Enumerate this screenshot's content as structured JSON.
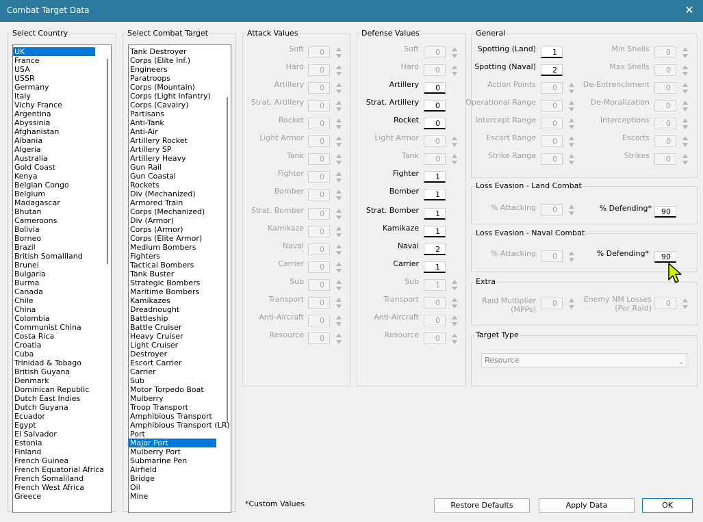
{
  "window": {
    "title": "Combat Target Data",
    "close_glyph": "✕"
  },
  "country": {
    "group_label": "Select Country",
    "items": [
      "UK",
      "France",
      "USA",
      "USSR",
      "Germany",
      "Italy",
      "Vichy France",
      "Argentina",
      "Abyssinia",
      "Afghanistan",
      "Albania",
      "Algeria",
      "Australia",
      "Gold Coast",
      "Kenya",
      "Belgian Congo",
      "Belgium",
      "Madagascar",
      "Bhutan",
      "Cameroons",
      "Bolivia",
      "Borneo",
      "Brazil",
      "British Somaliland",
      "Brunei",
      "Bulgaria",
      "Burma",
      "Canada",
      "Chile",
      "China",
      "Colombia",
      "Communist China",
      "Costa Rica",
      "Croatia",
      "Cuba",
      "Trinidad & Tobago",
      "British Guyana",
      "Denmark",
      "Dominican Republic",
      "Dutch East Indies",
      "Dutch Guyana",
      "Ecuador",
      "Egypt",
      "El Salvador",
      "Estonia",
      "Finland",
      "French Guinea",
      "French Equatorial Africa",
      "French Somaliland",
      "French West Africa",
      "Greece"
    ],
    "selected": "UK"
  },
  "target": {
    "group_label": "Select Combat Target",
    "items": [
      "Tank Destroyer",
      "Corps (Elite Inf.)",
      "Engineers",
      "Paratroops",
      "Corps (Mountain)",
      "Corps (Light Infantry)",
      "Corps (Cavalry)",
      "Partisans",
      "Anti-Tank",
      "Anti-Air",
      "Artillery Rocket",
      "Artillery SP",
      "Artillery Heavy",
      "Gun Rail",
      "Gun Coastal",
      "Rockets",
      "Div (Mechanized)",
      "Armored Train",
      "Corps (Mechanized)",
      "Div (Armor)",
      "Corps (Armor)",
      "Corps (Elite Armor)",
      "Medium Bombers",
      "Fighters",
      "Tactical Bombers",
      "Tank Buster",
      "Strategic Bombers",
      "Maritime Bombers",
      "Kamikazes",
      "Dreadnought",
      "Battleship",
      "Battle Cruiser",
      "Heavy Cruiser",
      "Light Cruiser",
      "Destroyer",
      "Escort Carrier",
      "Carrier",
      "Sub",
      "Motor Torpedo Boat",
      "Mulberry",
      "Troop Transport",
      "Amphibious Transport",
      "Amphibious Transport (LR)",
      "Port",
      "Major Port",
      "Mulberry Port",
      "Submarine Pen",
      "Airfield",
      "Bridge",
      "Oil",
      "Mine"
    ],
    "selected": "Major Port"
  },
  "attack": {
    "group_label": "Attack Values",
    "rows": [
      {
        "label": "Soft",
        "value": "0",
        "enabled": false
      },
      {
        "label": "Hard",
        "value": "0",
        "enabled": false
      },
      {
        "label": "Artillery",
        "value": "0",
        "enabled": false
      },
      {
        "label": "Strat. Artillery",
        "value": "0",
        "enabled": false
      },
      {
        "label": "Rocket",
        "value": "0",
        "enabled": false
      },
      {
        "label": "Light Armor",
        "value": "0",
        "enabled": false
      },
      {
        "label": "Tank",
        "value": "0",
        "enabled": false
      },
      {
        "label": "Fighter",
        "value": "0",
        "enabled": false
      },
      {
        "label": "Bomber",
        "value": "0",
        "enabled": false
      },
      {
        "label": "Strat. Bomber",
        "value": "0",
        "enabled": false
      },
      {
        "label": "Kamikaze",
        "value": "0",
        "enabled": false
      },
      {
        "label": "Naval",
        "value": "0",
        "enabled": false
      },
      {
        "label": "Carrier",
        "value": "0",
        "enabled": false
      },
      {
        "label": "Sub",
        "value": "0",
        "enabled": false
      },
      {
        "label": "Transport",
        "value": "0",
        "enabled": false
      },
      {
        "label": "Anti-Aircraft",
        "value": "0",
        "enabled": false
      },
      {
        "label": "Resource",
        "value": "0",
        "enabled": false
      }
    ]
  },
  "defense": {
    "group_label": "Defense Values",
    "rows": [
      {
        "label": "Soft",
        "value": "0",
        "enabled": false
      },
      {
        "label": "Hard",
        "value": "0",
        "enabled": false
      },
      {
        "label": "Artillery",
        "value": "0",
        "enabled": true
      },
      {
        "label": "Strat. Artillery",
        "value": "0",
        "enabled": true
      },
      {
        "label": "Rocket",
        "value": "0",
        "enabled": true
      },
      {
        "label": "Light Armor",
        "value": "0",
        "enabled": false
      },
      {
        "label": "Tank",
        "value": "0",
        "enabled": false
      },
      {
        "label": "Fighter",
        "value": "1",
        "enabled": true
      },
      {
        "label": "Bomber",
        "value": "1",
        "enabled": true
      },
      {
        "label": "Strat. Bomber",
        "value": "1",
        "enabled": true
      },
      {
        "label": "Kamikaze",
        "value": "1",
        "enabled": true
      },
      {
        "label": "Naval",
        "value": "2",
        "enabled": true
      },
      {
        "label": "Carrier",
        "value": "1",
        "enabled": true
      },
      {
        "label": "Sub",
        "value": "1",
        "enabled": false
      },
      {
        "label": "Transport",
        "value": "0",
        "enabled": false
      },
      {
        "label": "Anti-Aircraft",
        "value": "0",
        "enabled": false
      },
      {
        "label": "Resource",
        "value": "0",
        "enabled": false
      }
    ]
  },
  "general": {
    "group_label": "General",
    "left": [
      {
        "label": "Spotting (Land)",
        "value": "1",
        "enabled": true
      },
      {
        "label": "Spotting (Naval)",
        "value": "2",
        "enabled": true
      },
      {
        "label": "Action Points",
        "value": "0",
        "enabled": false
      },
      {
        "label": "Operational Range",
        "value": "0",
        "enabled": false
      },
      {
        "label": "Intercept Range",
        "value": "0",
        "enabled": false
      },
      {
        "label": "Escort Range",
        "value": "0",
        "enabled": false
      },
      {
        "label": "Strike Range",
        "value": "0",
        "enabled": false
      }
    ],
    "right": [
      {
        "label": "Min Shells",
        "value": "0",
        "enabled": false
      },
      {
        "label": "Max Shells",
        "value": "0",
        "enabled": false
      },
      {
        "label": "De-Entrenchment",
        "value": "0",
        "enabled": false
      },
      {
        "label": "De-Moralization",
        "value": "0",
        "enabled": false
      },
      {
        "label": "Interceptions",
        "value": "0",
        "enabled": false
      },
      {
        "label": "Escorts",
        "value": "0",
        "enabled": false
      },
      {
        "label": "Strikes",
        "value": "0",
        "enabled": false
      }
    ]
  },
  "loss_land": {
    "group_label": "Loss Evasion - Land Combat",
    "attacking_label": "% Attacking",
    "attacking_value": "0",
    "defending_label": "% Defending*",
    "defending_value": "90"
  },
  "loss_naval": {
    "group_label": "Loss Evasion - Naval Combat",
    "attacking_label": "% Attacking",
    "attacking_value": "0",
    "defending_label": "% Defending*",
    "defending_value": "90"
  },
  "extra": {
    "group_label": "Extra",
    "raid_label_1": "Raid Multiplier",
    "raid_label_2": "(MPPs)",
    "raid_value": "0",
    "enemy_label_1": "Enemy NM Losses",
    "enemy_label_2": "(Per Raid)",
    "enemy_value": "0"
  },
  "target_type": {
    "group_label": "Target Type",
    "value": "Resource"
  },
  "footer": {
    "note": "*Custom Values",
    "restore_label": "Restore Defaults",
    "apply_label": "Apply Data",
    "ok_label": "OK"
  },
  "colors": {
    "titlebar": "#2c7a9e",
    "selection": "#0078d7",
    "cursor": "#d4f000"
  },
  "icons": {
    "close": "close-icon",
    "cursor": "mouse-pointer-icon",
    "dropdown": "chevron-down-icon"
  }
}
